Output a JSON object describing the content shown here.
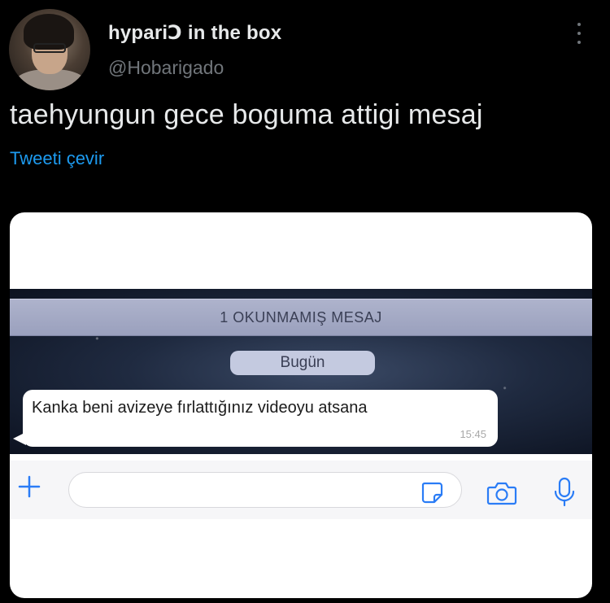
{
  "tweet": {
    "display_name": "hypariↃ in the box",
    "handle": "@Hobarigado",
    "text": "taehyungun gece boguma attigi mesaj",
    "translate_label": "Tweeti çevir",
    "more_icon": "more-vertical-icon"
  },
  "media": {
    "unread_banner": "1 OKUNMAMIŞ MESAJ",
    "date_label": "Bugün",
    "message": {
      "text": "Kanka beni avizeye fırlattığınız videoyu atsana",
      "time": "15:45"
    },
    "input_bar": {
      "icons": [
        "plus-icon",
        "sticker-icon",
        "camera-icon",
        "mic-icon"
      ]
    }
  },
  "colors": {
    "background": "#000000",
    "text_primary": "#e7e9ea",
    "text_secondary": "#71767b",
    "link": "#1d9bf0",
    "ios_blue": "#2a7cf6"
  }
}
